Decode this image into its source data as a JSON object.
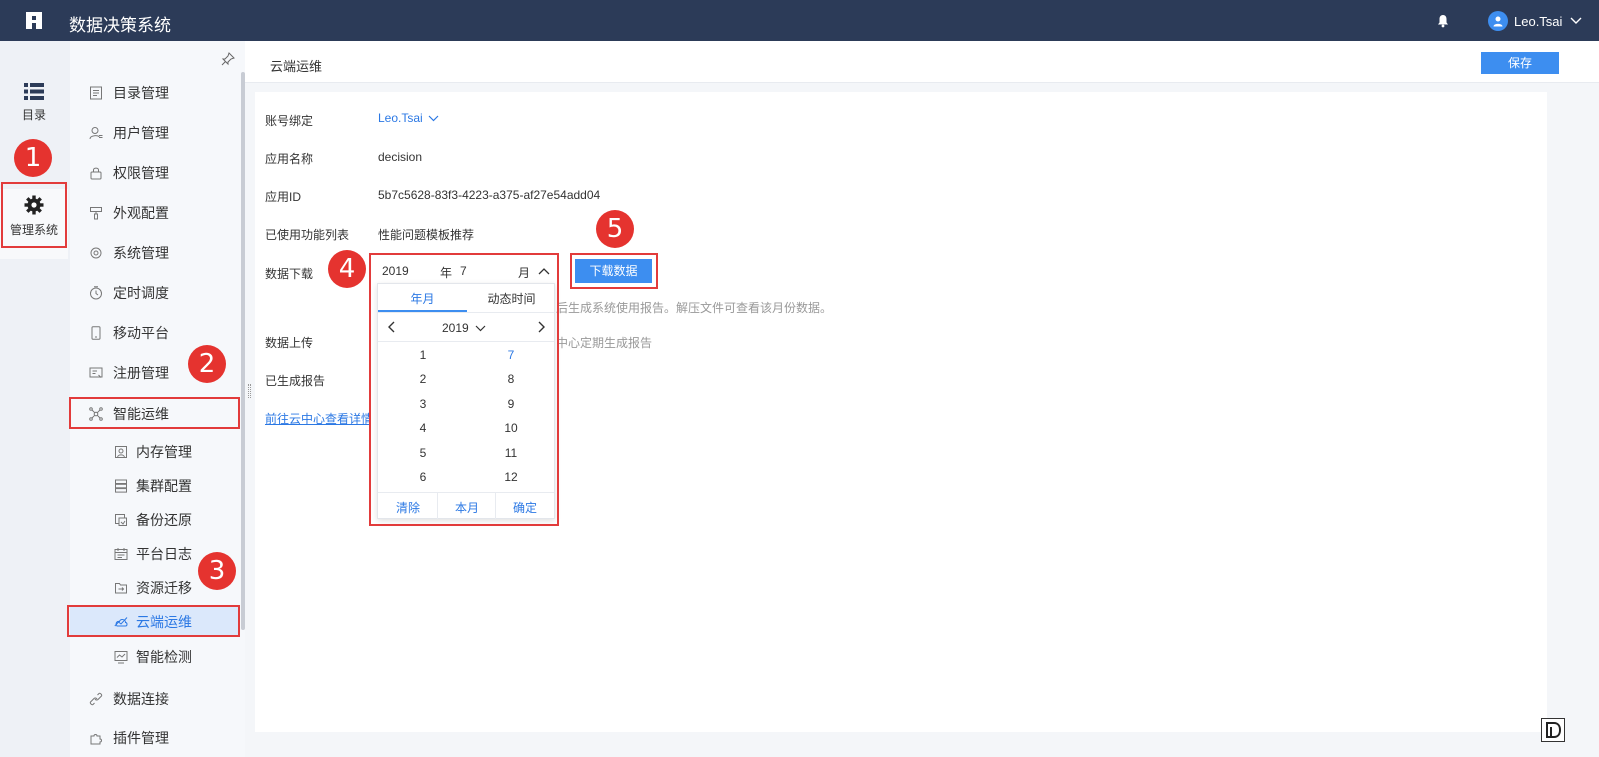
{
  "header": {
    "title": "数据决策系统",
    "user": "Leo.Tsai"
  },
  "rail": {
    "items": [
      {
        "label": "目录",
        "icon": "list-icon"
      },
      {
        "label": "管理系统",
        "icon": "gear-icon"
      }
    ]
  },
  "nav": {
    "items": [
      {
        "label": "目录管理",
        "icon": "catalog-icon"
      },
      {
        "label": "用户管理",
        "icon": "user-icon"
      },
      {
        "label": "权限管理",
        "icon": "lock-icon"
      },
      {
        "label": "外观配置",
        "icon": "brush-icon"
      },
      {
        "label": "系统管理",
        "icon": "gear-icon"
      },
      {
        "label": "定时调度",
        "icon": "clock-icon"
      },
      {
        "label": "移动平台",
        "icon": "mobile-icon"
      },
      {
        "label": "注册管理",
        "icon": "register-icon"
      },
      {
        "label": "智能运维",
        "icon": "network-icon"
      },
      {
        "label": "内存管理",
        "icon": "memory-icon"
      },
      {
        "label": "集群配置",
        "icon": "cluster-icon"
      },
      {
        "label": "备份还原",
        "icon": "backup-icon"
      },
      {
        "label": "平台日志",
        "icon": "log-icon"
      },
      {
        "label": "资源迁移",
        "icon": "migrate-icon"
      },
      {
        "label": "云端运维",
        "icon": "cloud-chart-icon"
      },
      {
        "label": "智能检测",
        "icon": "monitor-icon"
      },
      {
        "label": "数据连接",
        "icon": "link-icon"
      },
      {
        "label": "插件管理",
        "icon": "plugin-icon"
      }
    ]
  },
  "main": {
    "title": "云端运维",
    "save_label": "保存",
    "rows": {
      "account_label": "账号绑定",
      "account_value": "Leo.Tsai",
      "app_name_label": "应用名称",
      "app_name_value": "decision",
      "app_id_label": "应用ID",
      "app_id_value": "5b7c5628-83f3-4223-a375-af27e54add04",
      "features_label": "已使用功能列表",
      "features_value": "性能问题模板推荐",
      "download_label": "数据下载",
      "download_hint": "后生成系统使用报告。解压文件可查看该月份数据。",
      "upload_label": "数据上传",
      "upload_hint": "中心定期生成报告",
      "reports_label": "已生成报告",
      "cloud_link": "前往云中心查看详情"
    },
    "download_button": "下载数据",
    "picker": {
      "year": "2019",
      "year_unit": "年",
      "month": "7",
      "month_unit": "月",
      "tab_month": "年月",
      "tab_dynamic": "动态时间",
      "nav_year": "2019",
      "months_left": [
        "1",
        "2",
        "3",
        "4",
        "5",
        "6"
      ],
      "months_right": [
        "7",
        "8",
        "9",
        "10",
        "11",
        "12"
      ],
      "selected_month": "7",
      "clear": "清除",
      "this_month": "本月",
      "confirm": "确定"
    }
  },
  "annotations": [
    "1",
    "2",
    "3",
    "4",
    "5"
  ],
  "colors": {
    "topbar": "#2c3b58",
    "accent": "#3d8ef0",
    "annotation": "#e23b3b"
  }
}
